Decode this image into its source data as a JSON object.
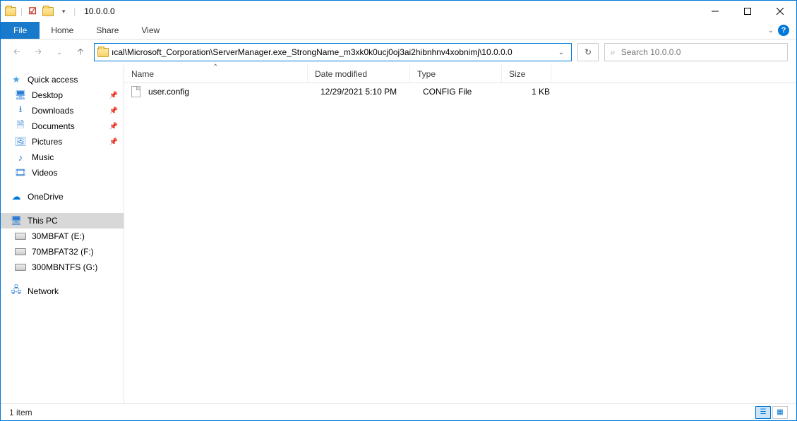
{
  "window": {
    "title": "10.0.0.0"
  },
  "ribbon": {
    "file": "File",
    "tabs": [
      "Home",
      "Share",
      "View"
    ]
  },
  "address": {
    "path": "ıcal\\Microsoft_Corporation\\ServerManager.exe_StrongName_m3xk0k0ucj0oj3ai2hibnhnv4xobnimj\\10.0.0.0"
  },
  "search": {
    "placeholder": "Search 10.0.0.0"
  },
  "nav": {
    "quick_access": "Quick access",
    "quick_items": [
      {
        "label": "Desktop",
        "pinned": true
      },
      {
        "label": "Downloads",
        "pinned": true
      },
      {
        "label": "Documents",
        "pinned": true
      },
      {
        "label": "Pictures",
        "pinned": true
      },
      {
        "label": "Music",
        "pinned": false
      },
      {
        "label": "Videos",
        "pinned": false
      }
    ],
    "onedrive": "OneDrive",
    "this_pc": "This PC",
    "drives": [
      {
        "label": "30MBFAT (E:)"
      },
      {
        "label": "70MBFAT32 (F:)"
      },
      {
        "label": "300MBNTFS (G:)"
      }
    ],
    "network": "Network"
  },
  "columns": {
    "name": "Name",
    "date": "Date modified",
    "type": "Type",
    "size": "Size"
  },
  "files": [
    {
      "name": "user.config",
      "date": "12/29/2021 5:10 PM",
      "type": "CONFIG File",
      "size": "1 KB"
    }
  ],
  "status": {
    "text": "1 item"
  }
}
